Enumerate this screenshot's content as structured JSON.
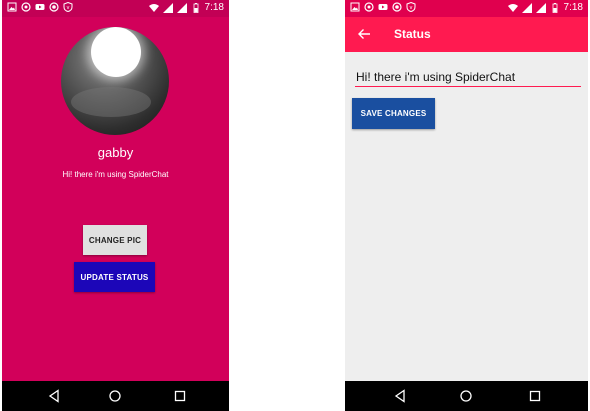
{
  "status_bar": {
    "time": "7:18"
  },
  "profile_screen": {
    "user_name": "gabby",
    "user_status": "Hi! there i'm using SpiderChat",
    "change_pic_label": "CHANGE PIC",
    "update_status_label": "UPDATE STATUS"
  },
  "status_screen": {
    "title": "Status",
    "status_value": "Hi! there i'm using SpiderChat",
    "save_label": "SAVE CHANGES"
  },
  "colors": {
    "profile_bg": "#D2005A",
    "appbar": "#FF1A50",
    "update_button": "#1C06B8",
    "save_button": "#1A4FA0"
  }
}
